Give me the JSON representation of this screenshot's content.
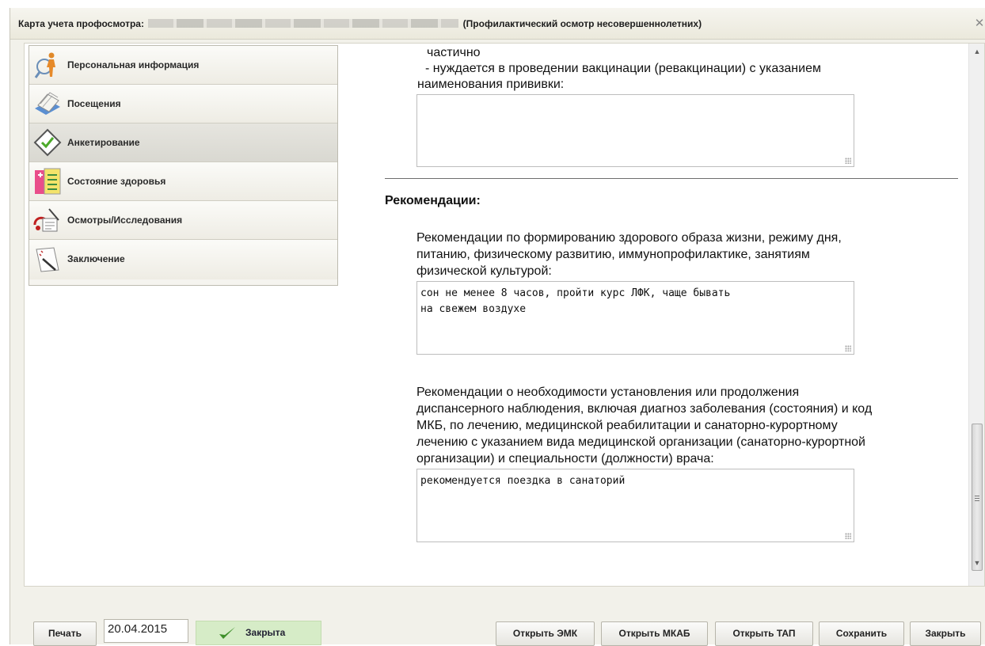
{
  "window": {
    "title_prefix": "Карта учета профосмотра:",
    "title_suffix": "(Профилактический осмотр несовершеннолетних)",
    "close_glyph": "✕"
  },
  "nav": {
    "items": [
      {
        "label": "Персональная информация",
        "icon": "person-icon"
      },
      {
        "label": "Посещения",
        "icon": "card-file-icon"
      },
      {
        "label": "Анкетирование",
        "icon": "checkmark-clipboard-icon",
        "active": true
      },
      {
        "label": "Состояние здоровья",
        "icon": "health-chart-icon"
      },
      {
        "label": "Осмотры/Исследования",
        "icon": "exam-icon"
      },
      {
        "label": "Заключение",
        "icon": "conclusion-document-icon"
      }
    ]
  },
  "form": {
    "partial_line": "частично",
    "vaccination_line1": "- нуждается в проведении вакцинации (ревакцинации) с указанием",
    "vaccination_line2": "наименования прививки:",
    "vaccination_value": "",
    "recommendations_heading": "Рекомендации:",
    "rec1_lines": [
      "Рекомендации по формированию здорового образа жизни, режиму дня,",
      "питанию, физическому развитию, иммунопрофилактике, занятиям",
      "физической культурой:"
    ],
    "rec1_value": "сон не менее 8 часов, пройти курс ЛФК, чаще бывать\nна свежем воздухе",
    "rec2_lines": [
      "Рекомендации о необходимости установления или продолжения",
      "диспансерного наблюдения, включая диагноз заболевания (состояния) и код",
      "МКБ, по лечению, медицинской реабилитации и санаторно-курортному",
      "лечению с указанием вида медицинской организации (санаторно-курортной",
      "организации) и специальности (должности) врача:"
    ],
    "rec2_value": "рекомендуется поездка в санаторий"
  },
  "scrollbar": {
    "up": "▲",
    "down": "▼"
  },
  "footer": {
    "print_label": "Печать",
    "date_value": "20.04.2015",
    "status_label": "Закрыта",
    "open_emk_label": "Открыть ЭМК",
    "open_mkab_label": "Открыть МКАБ",
    "open_tap_label": "Открыть ТАП",
    "save_label": "Сохранить",
    "close_label": "Закрыть"
  }
}
